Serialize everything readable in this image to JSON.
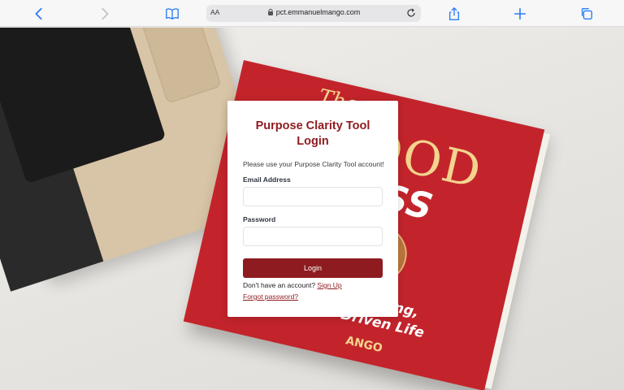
{
  "browser": {
    "text_size_label": "AA",
    "url": "pct.emmanuelmango.com"
  },
  "login": {
    "title_line1": "Purpose Clarity Tool",
    "title_line2": "Login",
    "intro": "Please use your Purpose Clarity Tool account!",
    "email_label": "Email Address",
    "email_value": "",
    "password_label": "Password",
    "password_value": "",
    "login_button": "Login",
    "no_account_text": "Don't have an account?",
    "signup_link": "Sign Up",
    "forgot_link": "Forgot password?"
  },
  "background": {
    "book_title_small": "The",
    "book_title_large": "GOOD",
    "book_title_bold": "CCESS",
    "book_subtitle_line1": "Fulfilling,",
    "book_subtitle_line2": "-Driven Life",
    "book_author": "ANGO"
  },
  "colors": {
    "accent": "#8e1b1f",
    "toolbar_icon": "#2b7cf6",
    "book_red": "#c3242b"
  }
}
